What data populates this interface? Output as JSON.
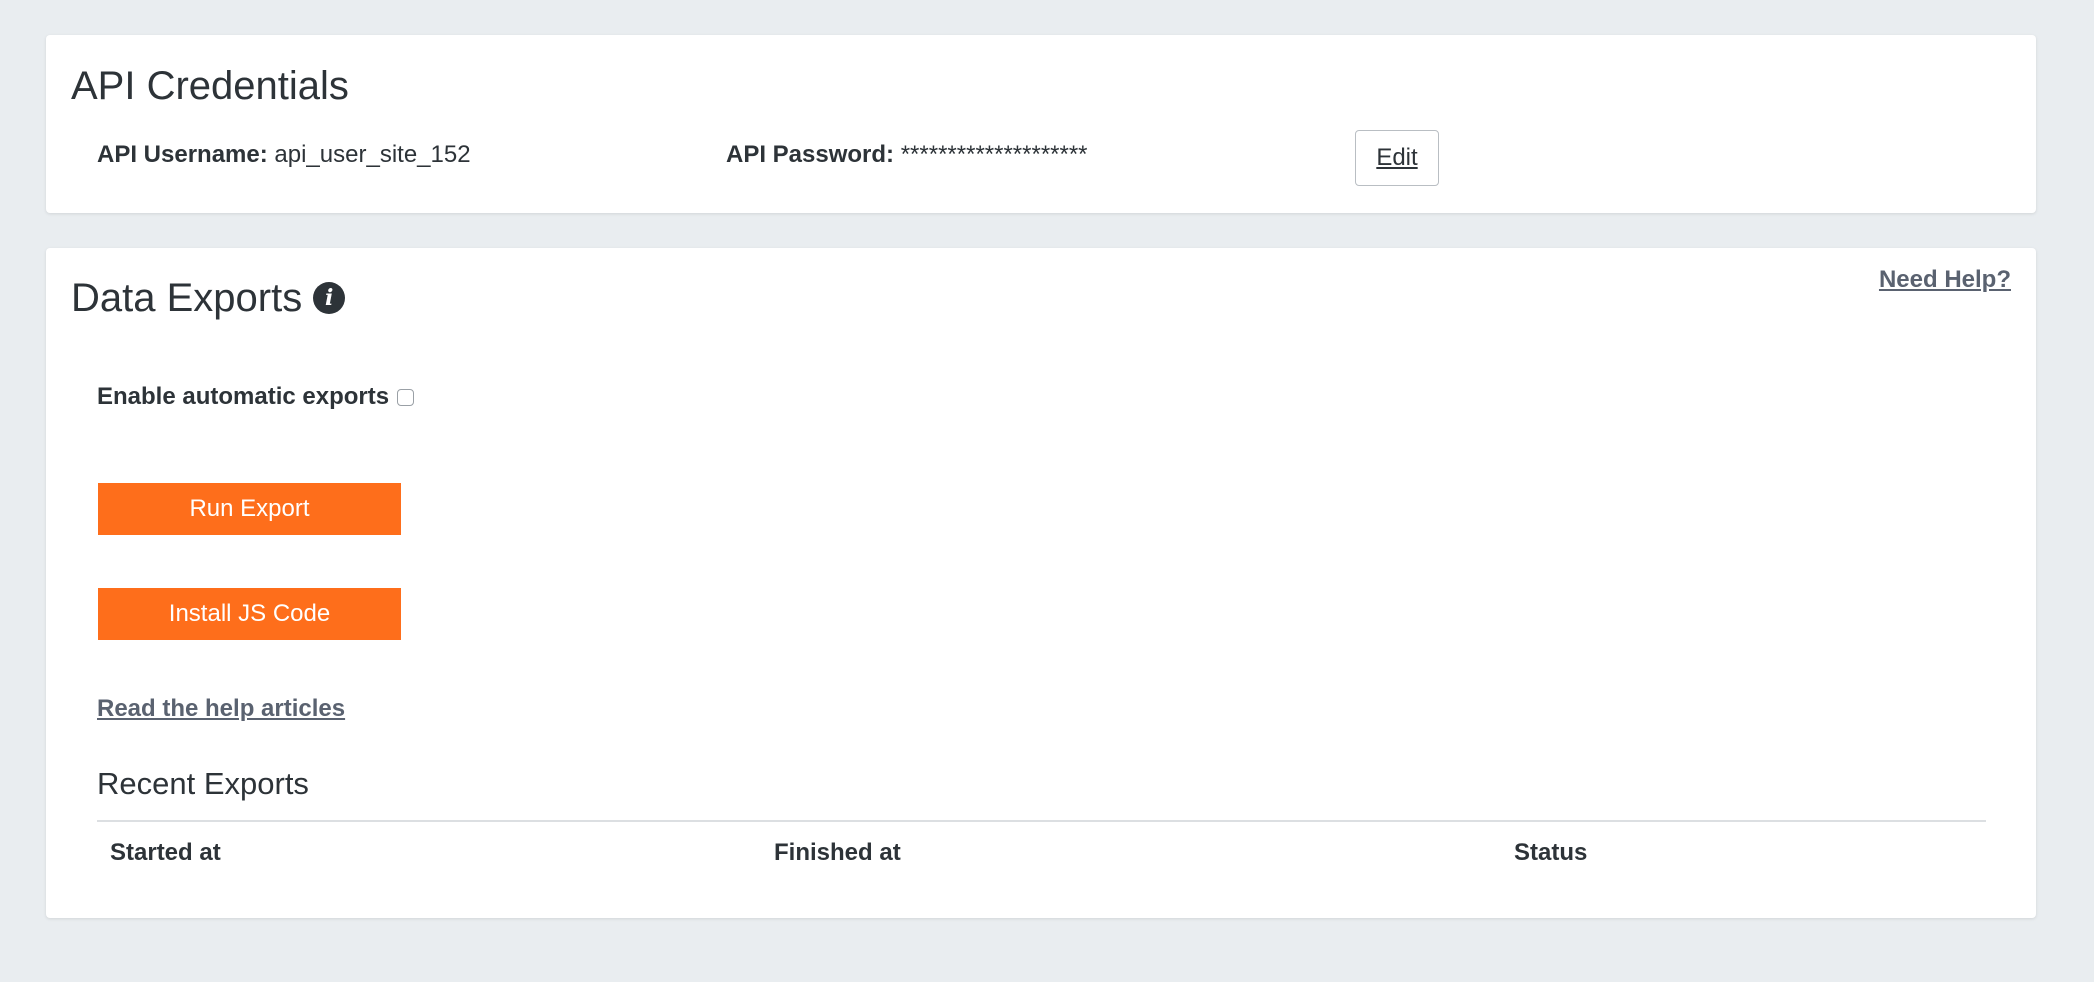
{
  "credentials": {
    "title": "API Credentials",
    "username_label": "API Username:",
    "username_value": "api_user_site_152",
    "password_label": "API Password:",
    "password_value": "********************",
    "edit_label": "Edit"
  },
  "exports": {
    "title": "Data Exports",
    "info_icon": "info-icon",
    "need_help_label": "Need Help?",
    "auto_export_label": "Enable automatic exports",
    "auto_export_checked": false,
    "run_export_label": "Run Export",
    "install_js_label": "Install JS Code",
    "help_articles_label": "Read the help articles",
    "recent_title": "Recent Exports",
    "table_headers": [
      "Started at",
      "Finished at",
      "Status"
    ],
    "table_rows": []
  },
  "colors": {
    "background": "#e9edf0",
    "card": "#ffffff",
    "accent_orange": "#fe6e1b",
    "text": "#2d3338",
    "link": "#5a6270"
  }
}
